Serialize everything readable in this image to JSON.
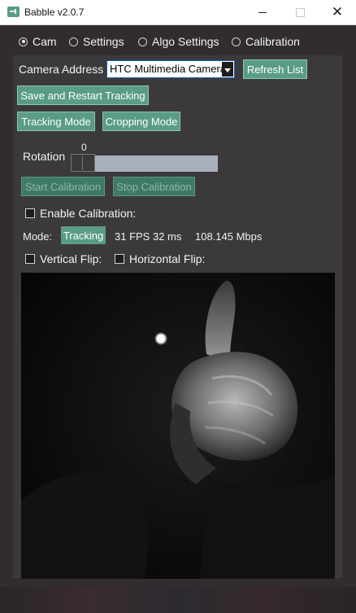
{
  "window": {
    "title": "Babble v2.0.7",
    "controls": {
      "minimize": "",
      "maximize": "",
      "close": "✕"
    }
  },
  "tabs": [
    {
      "label": "Cam",
      "selected": true
    },
    {
      "label": "Settings",
      "selected": false
    },
    {
      "label": "Algo Settings",
      "selected": false
    },
    {
      "label": "Calibration",
      "selected": false
    }
  ],
  "camera": {
    "address_label": "Camera Address",
    "address_value": "HTC Multimedia Camera",
    "refresh_button": "Refresh List",
    "save_restart_button": "Save and Restart Tracking",
    "tracking_mode_button": "Tracking Mode",
    "cropping_mode_button": "Cropping Mode",
    "rotation_label": "Rotation",
    "rotation_value": "0",
    "start_calibration_button": "Start Calibration",
    "stop_calibration_button": "Stop Calibration",
    "enable_calibration_label": "Enable Calibration:",
    "mode_label": "Mode:",
    "mode_value": "Tracking",
    "fps_text": "31 FPS 32 ms",
    "bandwidth_text": "108.145 Mbps",
    "vertical_flip_label": "Vertical Flip:",
    "horizontal_flip_label": "Horizontal Flip:"
  },
  "colors": {
    "accent": "#5a9c86",
    "window_bg": "#302c30",
    "panel_bg": "#3c393c"
  }
}
